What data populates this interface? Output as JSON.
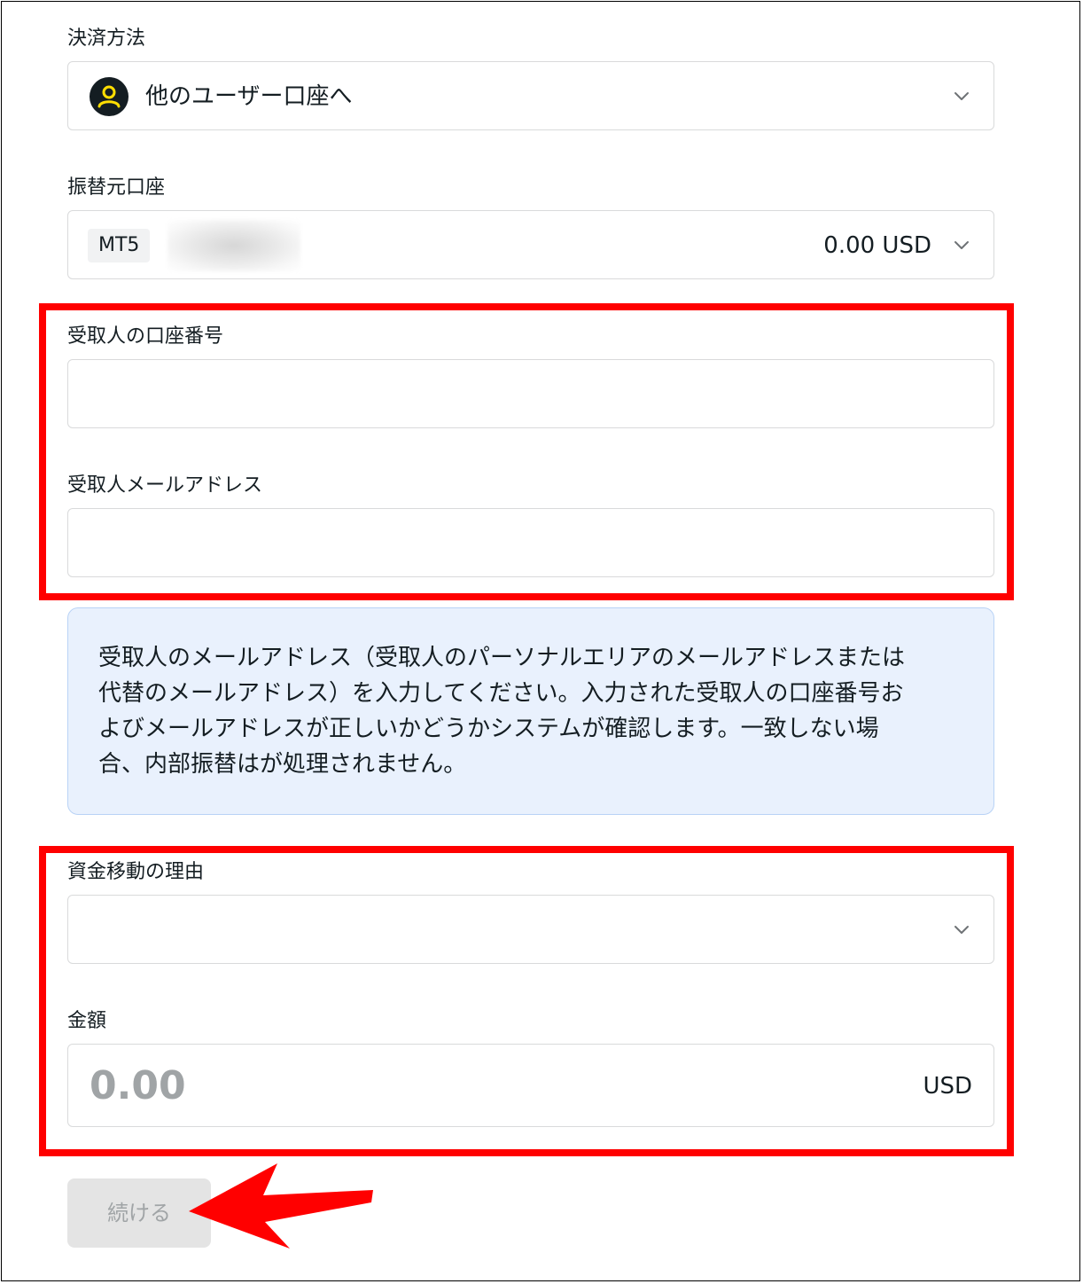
{
  "payment_method": {
    "label": "決済方法",
    "selected": "他のユーザー口座へ",
    "icon": "user-icon"
  },
  "source_account": {
    "label": "振替元口座",
    "platform_badge": "MT5",
    "balance": "0.00 USD"
  },
  "recipient_account_number": {
    "label": "受取人の口座番号",
    "value": ""
  },
  "recipient_email": {
    "label": "受取人メールアドレス",
    "value": ""
  },
  "info": {
    "line1": "受取人のメールアドレス（受取人のパーソナルエリアのメールアドレスまたは",
    "line2": "代替のメールアドレス）を入力してください。入力された受取人の口座番号お",
    "line3": "よびメールアドレスが正しいかどうかシステムが確認します。一致しない場",
    "line4": "合、内部振替はが処理されません。"
  },
  "transfer_reason": {
    "label": "資金移動の理由",
    "selected": ""
  },
  "amount": {
    "label": "金額",
    "placeholder": "0.00",
    "currency": "USD"
  },
  "actions": {
    "continue_label": "続ける"
  },
  "colors": {
    "annotation_red": "#ff0000",
    "avatar_bg": "#141d22",
    "avatar_fg": "#ffde02",
    "info_bg": "#e9f1fd",
    "info_border": "#b9d3f6",
    "button_disabled_bg": "#e4e4e4",
    "button_disabled_text": "#a0a4a6"
  }
}
